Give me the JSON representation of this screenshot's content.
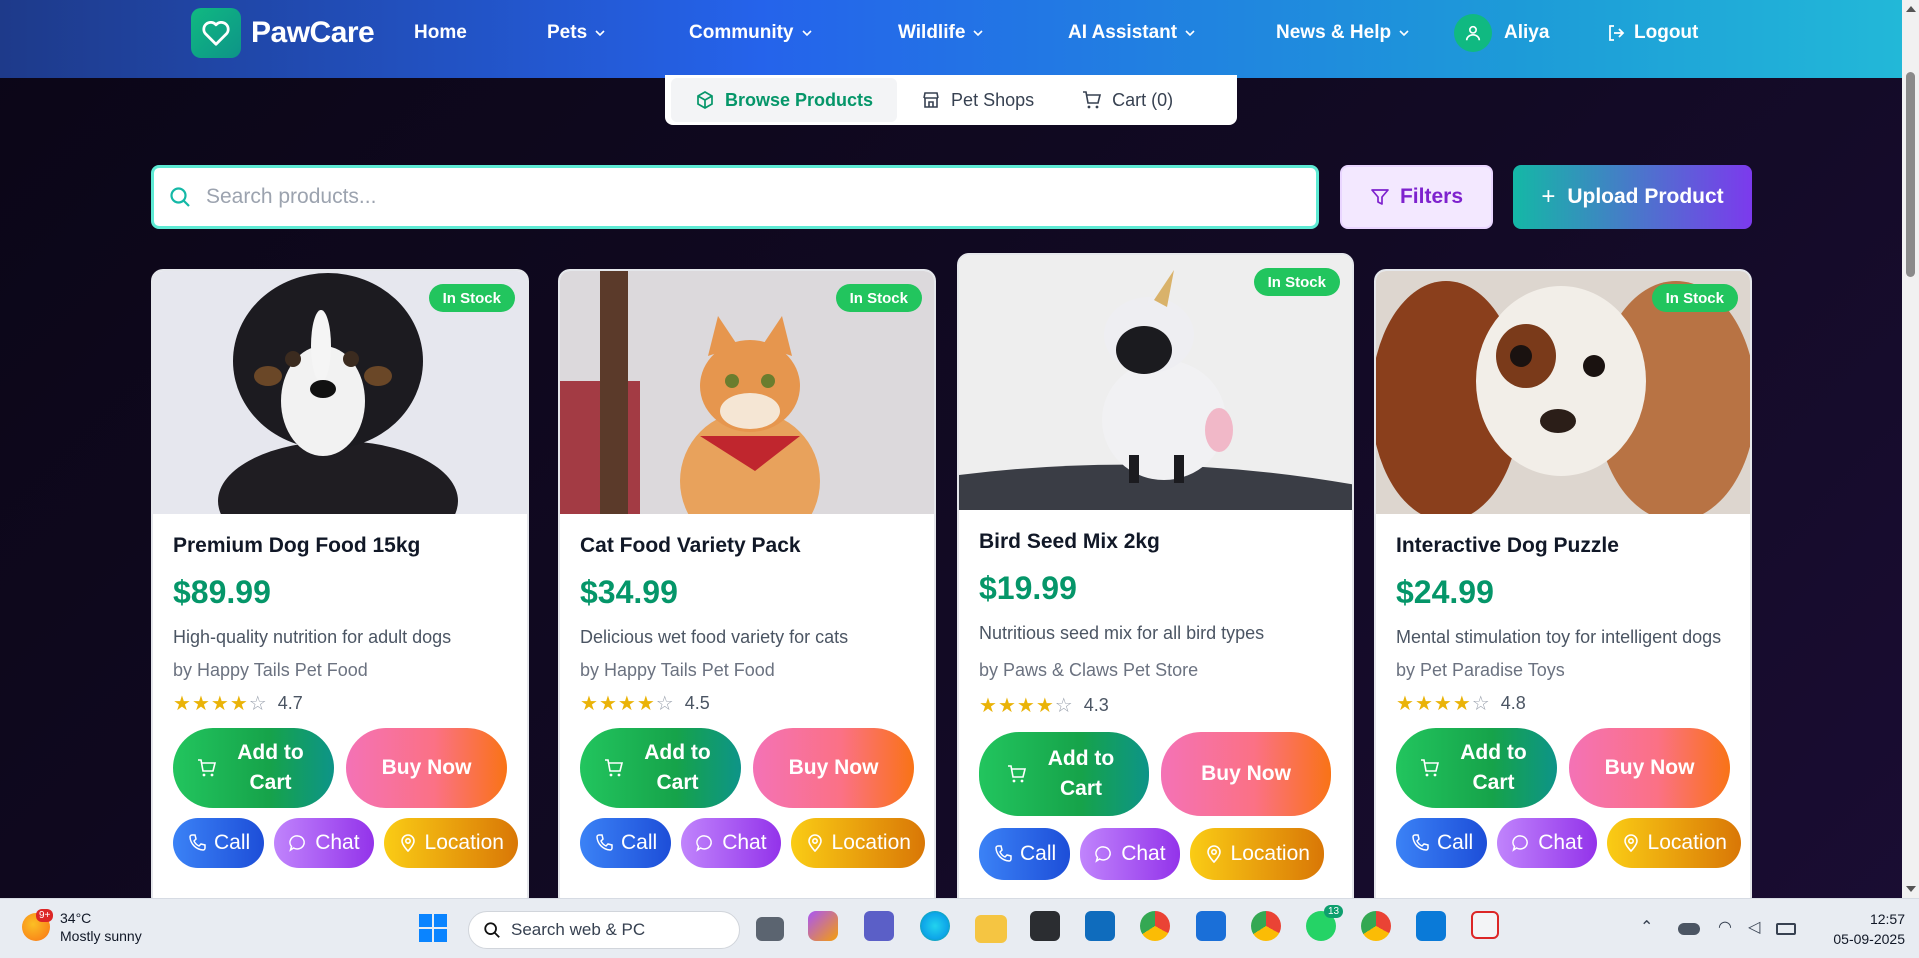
{
  "app": {
    "name": "PawCare"
  },
  "nav": {
    "home": "Home",
    "pets": "Pets",
    "community": "Community",
    "wildlife": "Wildlife",
    "ai": "AI Assistant",
    "news": "News & Help",
    "user": "Aliya",
    "logout": "Logout"
  },
  "tabs": {
    "browse": "Browse Products",
    "shops": "Pet Shops",
    "cart": "Cart (0)"
  },
  "search": {
    "placeholder": "Search products..."
  },
  "toolbar": {
    "filters": "Filters",
    "upload": "Upload Product"
  },
  "products": [
    {
      "stock": "In Stock",
      "title": "Premium Dog Food 15kg",
      "price": "$89.99",
      "desc": "High-quality nutrition for adult dogs",
      "seller": "by Happy Tails Pet Food",
      "rating": "4.7",
      "stars": 4,
      "add": "Add to Cart",
      "buy": "Buy Now",
      "call": "Call",
      "chat": "Chat",
      "location": "Location"
    },
    {
      "stock": "In Stock",
      "title": "Cat Food Variety Pack",
      "price": "$34.99",
      "desc": "Delicious wet food variety for cats",
      "seller": "by Happy Tails Pet Food",
      "rating": "4.5",
      "stars": 4,
      "add": "Add to Cart",
      "buy": "Buy Now",
      "call": "Call",
      "chat": "Chat",
      "location": "Location"
    },
    {
      "stock": "In Stock",
      "title": "Bird Seed Mix 2kg",
      "price": "$19.99",
      "desc": "Nutritious seed mix for all bird types",
      "seller": "by Paws & Claws Pet Store",
      "rating": "4.3",
      "stars": 4,
      "add": "Add to Cart",
      "buy": "Buy Now",
      "call": "Call",
      "chat": "Chat",
      "location": "Location"
    },
    {
      "stock": "In Stock",
      "title": "Interactive Dog Puzzle",
      "price": "$24.99",
      "desc": "Mental stimulation toy for intelligent dogs",
      "seller": "by Pet Paradise Toys",
      "rating": "4.8",
      "stars": 4,
      "add": "Add to Cart",
      "buy": "Buy Now",
      "call": "Call",
      "chat": "Chat",
      "location": "Location"
    }
  ],
  "taskbar": {
    "weather_badge": "9+",
    "temp": "34°C",
    "condition": "Mostly sunny",
    "search": "Search web & PC",
    "whatsapp_badge": "13",
    "time": "12:57",
    "date": "05-09-2025"
  },
  "colors": {
    "brand": "#10b981",
    "price": "#059669",
    "stock_badge": "#22c55e"
  }
}
